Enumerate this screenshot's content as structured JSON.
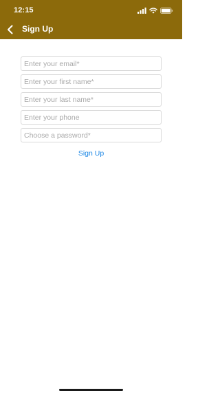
{
  "status_bar": {
    "time": "12:15",
    "icons": [
      "cellular-signal-icon",
      "wifi-icon",
      "battery-icon"
    ]
  },
  "nav": {
    "back_icon": "chevron-left-icon",
    "title": "Sign Up"
  },
  "form": {
    "email_placeholder": "Enter your email*",
    "first_name_placeholder": "Enter your first name*",
    "last_name_placeholder": "Enter your last name*",
    "phone_placeholder": "Enter your phone",
    "password_placeholder": "Choose a password*",
    "submit_label": "Sign Up"
  },
  "colors": {
    "header_background": "#8c6a0b",
    "link": "#1e88e5"
  }
}
